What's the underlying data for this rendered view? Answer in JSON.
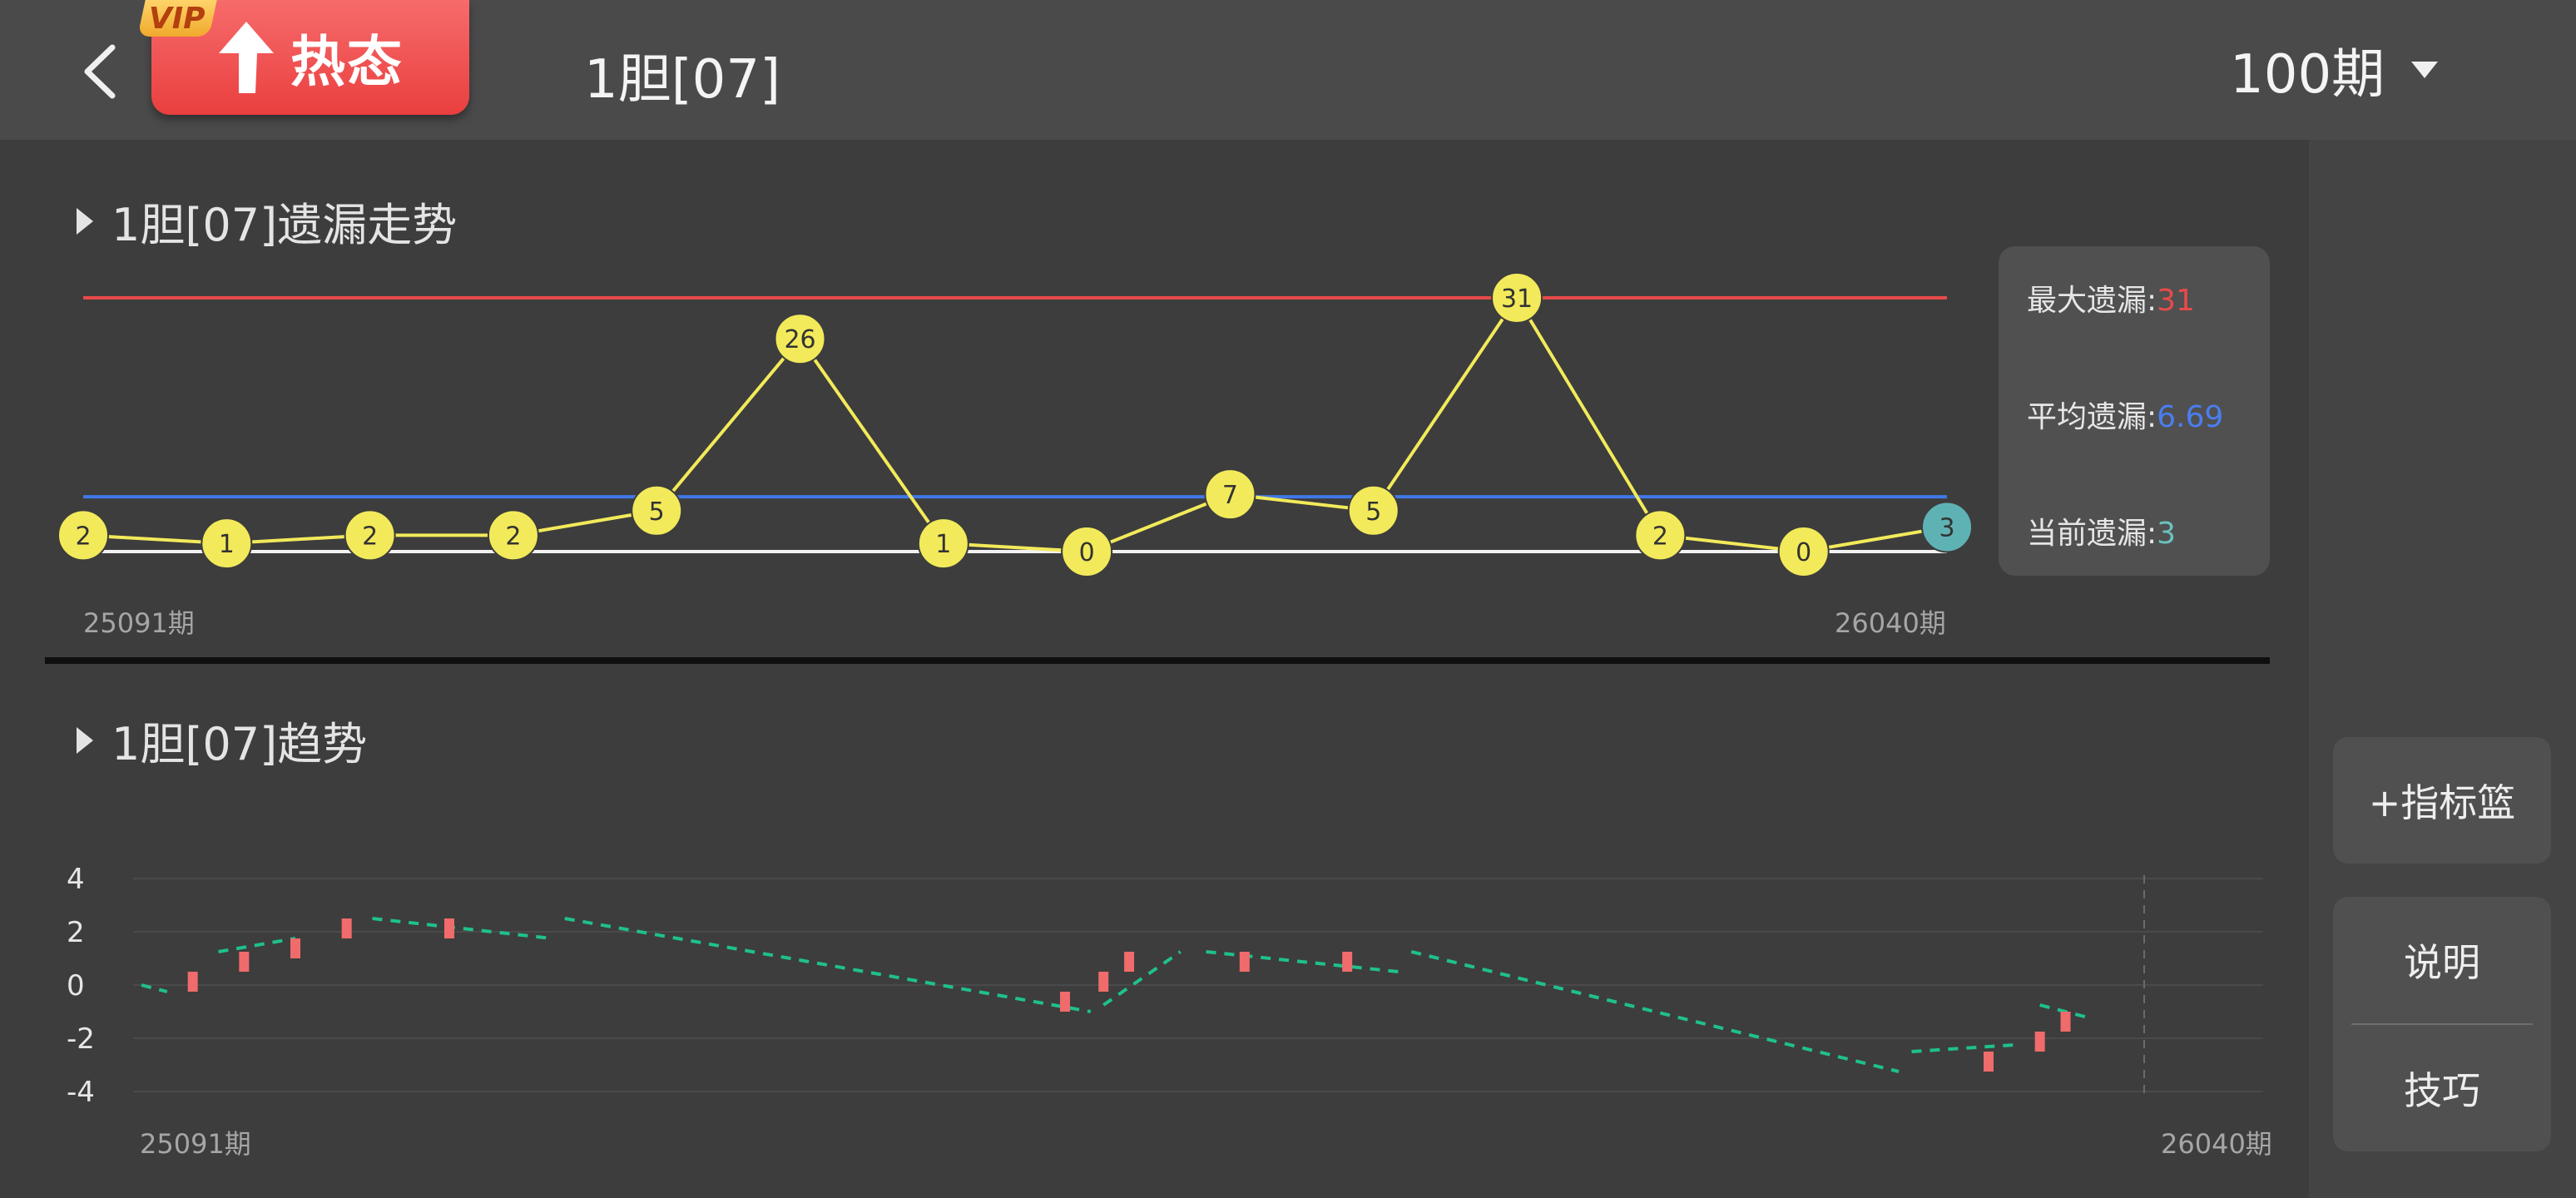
{
  "header": {
    "vip_badge": "VIP",
    "hot_label": "热态",
    "title": "1胆[07]",
    "period_select": "100期"
  },
  "omission_section": {
    "title": "1胆[07]遗漏走势",
    "stats": {
      "max_label": "最大遗漏:",
      "max_value": "31",
      "avg_label": "平均遗漏:",
      "avg_value": "6.69",
      "current_label": "当前遗漏:",
      "current_value": "3"
    }
  },
  "trend_section": {
    "title": "1胆[07]趋势"
  },
  "side_buttons": {
    "indicator_basket": "+指标篮",
    "explain": "说明",
    "tips": "技巧"
  },
  "colors": {
    "max_line": "#e84a4a",
    "avg_line": "#3f78e8",
    "omission_line": "#f2ea5a",
    "current_node": "#5fb2b4",
    "trend_dash": "#1fc08e",
    "candle": "#f06b6b"
  },
  "chart_data": [
    {
      "type": "line",
      "title": "1胆[07]遗漏走势",
      "x_start_label": "25091期",
      "x_end_label": "26040期",
      "values": [
        2,
        1,
        2,
        2,
        5,
        26,
        1,
        0,
        7,
        5,
        31,
        2,
        0,
        3
      ],
      "reference_lines": {
        "max": 31,
        "avg": 6.69
      },
      "current_value": 3
    },
    {
      "type": "line",
      "title": "1胆[07]趋势",
      "x_start_label": "25091期",
      "x_end_label": "26040期",
      "y_ticks": [
        "4",
        "2",
        "0",
        "-2",
        "-4"
      ],
      "ylim": [
        -4,
        4
      ],
      "trend_segments": [
        [
          [
            0,
            0
          ],
          [
            1,
            -0.25
          ]
        ],
        [
          [
            3,
            1.25
          ],
          [
            6,
            1.75
          ]
        ],
        [
          [
            9,
            2.5
          ],
          [
            16,
            1.75
          ]
        ],
        [
          [
            16.5,
            2.5
          ],
          [
            37,
            -1
          ]
        ],
        [
          [
            37.5,
            -0.75
          ],
          [
            40.5,
            1.25
          ]
        ],
        [
          [
            41.5,
            1.25
          ],
          [
            49,
            0.5
          ]
        ],
        [
          [
            49.5,
            1.25
          ],
          [
            68.5,
            -3.25
          ]
        ],
        [
          [
            69,
            -2.5
          ],
          [
            73,
            -2.25
          ]
        ],
        [
          [
            74,
            -0.75
          ],
          [
            76,
            -1.25
          ]
        ]
      ],
      "candles": [
        {
          "x": 2,
          "low": -0.25,
          "high": 0.5
        },
        {
          "x": 4,
          "low": 0.5,
          "high": 1.25
        },
        {
          "x": 6,
          "low": 1.0,
          "high": 1.75
        },
        {
          "x": 8,
          "low": 1.75,
          "high": 2.5
        },
        {
          "x": 12,
          "low": 1.75,
          "high": 2.5
        },
        {
          "x": 36,
          "low": -1,
          "high": -0.25
        },
        {
          "x": 37.5,
          "low": -0.25,
          "high": 0.5
        },
        {
          "x": 38.5,
          "low": 0.5,
          "high": 1.25
        },
        {
          "x": 43,
          "low": 0.5,
          "high": 1.25
        },
        {
          "x": 47,
          "low": 0.5,
          "high": 1.25
        },
        {
          "x": 72,
          "low": -3.25,
          "high": -2.5
        },
        {
          "x": 74,
          "low": -2.5,
          "high": -1.75
        },
        {
          "x": 75,
          "low": -1.75,
          "high": -1.0
        }
      ],
      "x_max": 78
    }
  ]
}
